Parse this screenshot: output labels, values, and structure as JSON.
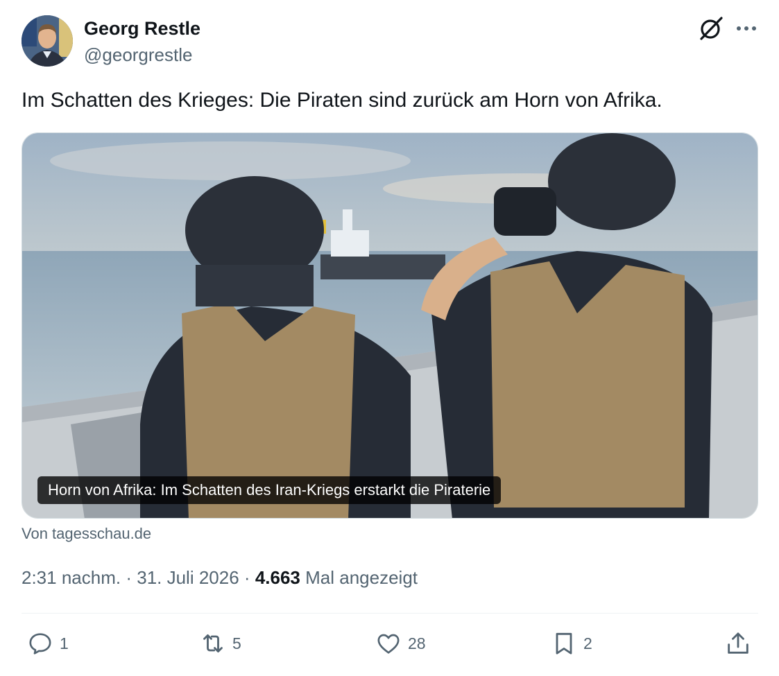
{
  "author": {
    "name": "Georg Restle",
    "handle": "@georgrestle"
  },
  "tweet": {
    "text": "Im Schatten des Krieges: Die Piraten sind zurück am Horn von Afrika."
  },
  "card": {
    "caption": "Horn von Afrika: Im Schatten des Iran-Kriegs erstarkt die Piraterie",
    "source": "Von tagesschau.de"
  },
  "meta": {
    "time": "2:31 nachm.",
    "separator": "·",
    "date": "31. Juli 2026",
    "views": "4.663",
    "views_label": "Mal angezeigt"
  },
  "actions": {
    "replies": "1",
    "reposts": "5",
    "likes": "28",
    "bookmarks": "2"
  },
  "colors": {
    "text": "#0f1419",
    "secondary": "#536471",
    "icon": "#536471"
  },
  "icons": [
    "grok-icon",
    "more-icon",
    "reply-icon",
    "repost-icon",
    "like-icon",
    "bookmark-icon",
    "share-icon"
  ]
}
